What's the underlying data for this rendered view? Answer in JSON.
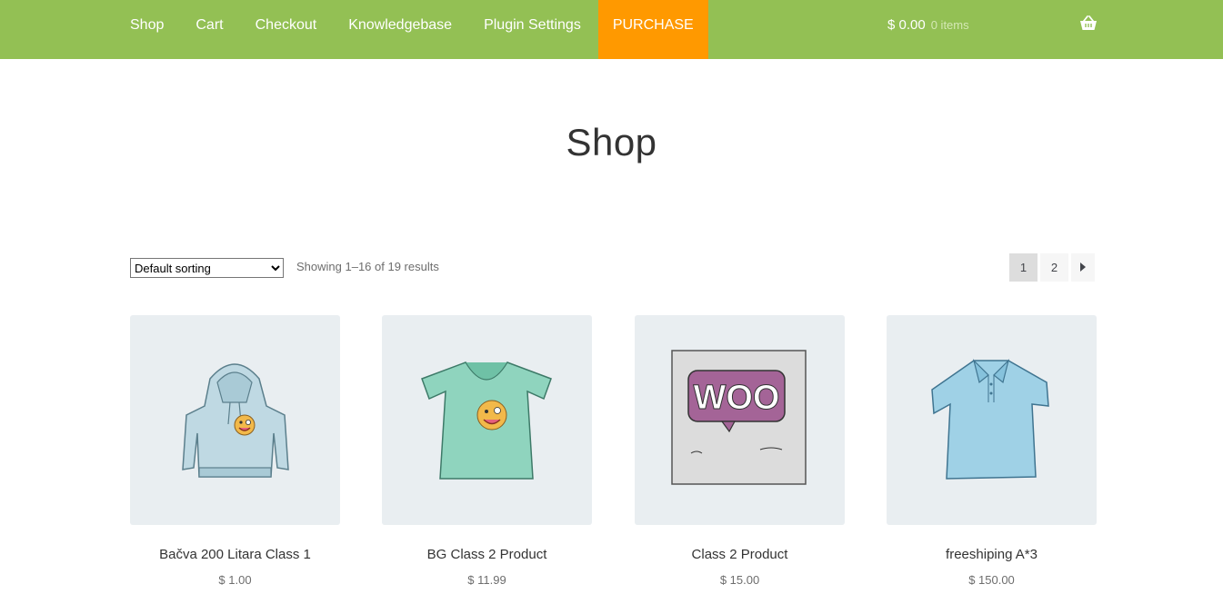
{
  "nav": {
    "items": [
      {
        "label": "Shop"
      },
      {
        "label": "Cart"
      },
      {
        "label": "Checkout"
      },
      {
        "label": "Knowledgebase"
      },
      {
        "label": "Plugin Settings"
      },
      {
        "label": "PURCHASE"
      }
    ],
    "cart_total": "$ 0.00",
    "cart_count": "0 items"
  },
  "page": {
    "title": "Shop",
    "sorting": "Default sorting",
    "results": "Showing 1–16 of 19 results",
    "pages": [
      "1",
      "2"
    ]
  },
  "products": [
    {
      "name": "Bačva 200 Litara Class 1",
      "price": "$ 1.00",
      "image": "hoodie"
    },
    {
      "name": "BG Class 2 Product",
      "price": "$ 11.99",
      "image": "tshirt"
    },
    {
      "name": "Class 2 Product",
      "price": "$ 15.00",
      "image": "album"
    },
    {
      "name": "freeshiping A*3",
      "price": "$ 150.00",
      "image": "polo"
    }
  ],
  "colors": {
    "header": "#93c054",
    "purchase": "#ff9900",
    "thumb_bg": "#e9eef1"
  }
}
